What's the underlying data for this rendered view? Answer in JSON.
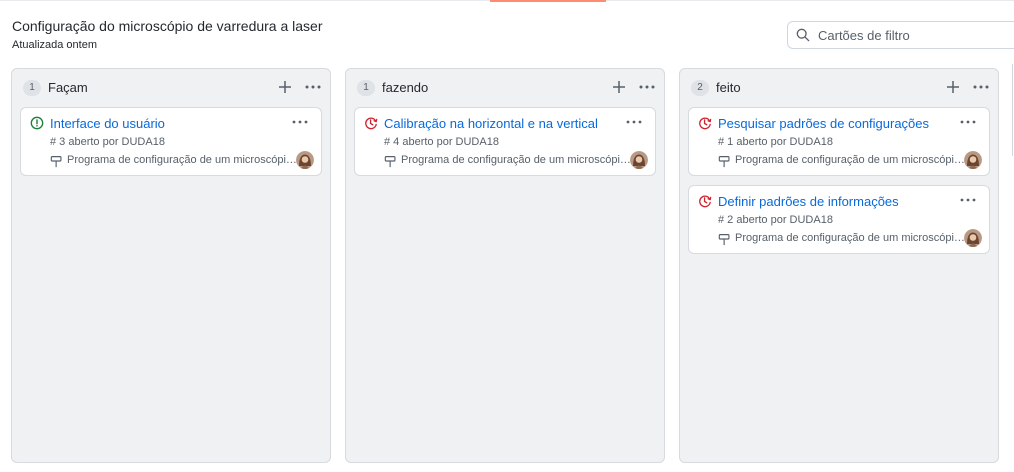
{
  "header": {
    "title": "Configuração do microscópio de varredura a laser",
    "subtitle": "Atualizada ontem"
  },
  "filter": {
    "placeholder": "Cartões de filtro"
  },
  "colors": {
    "link": "#0969da",
    "open_issue": "#1a7f37",
    "in_progress_issue": "#cf222e",
    "tab_accent": "#fd8c73",
    "column_bg": "#f0f1f3"
  },
  "columns": [
    {
      "count": "1",
      "name": "Façam",
      "cards": [
        {
          "status_icon": "issue-opened-icon",
          "title": "Interface do usuário",
          "meta": "# 3 aberto por DUDA18",
          "project": "Programa de configuração de um microscópio de varredura a laser"
        }
      ]
    },
    {
      "count": "1",
      "name": "fazendo",
      "cards": [
        {
          "status_icon": "issue-reopened-icon",
          "title": "Calibração na horizontal e na vertical",
          "meta": "# 4 aberto por DUDA18",
          "project": "Programa de configuração de um microscópio de varredura a laser"
        }
      ]
    },
    {
      "count": "2",
      "name": "feito",
      "cards": [
        {
          "status_icon": "issue-reopened-icon",
          "title": "Pesquisar padrões de configurações",
          "meta": "# 1 aberto por DUDA18",
          "project": "Programa de configuração de um microscópio de varredura a laser"
        },
        {
          "status_icon": "issue-reopened-icon",
          "title": "Definir padrões de informações",
          "meta": "# 2 aberto por DUDA18",
          "project": "Programa de configuração de um microscópio de varredura a laser"
        }
      ]
    }
  ]
}
